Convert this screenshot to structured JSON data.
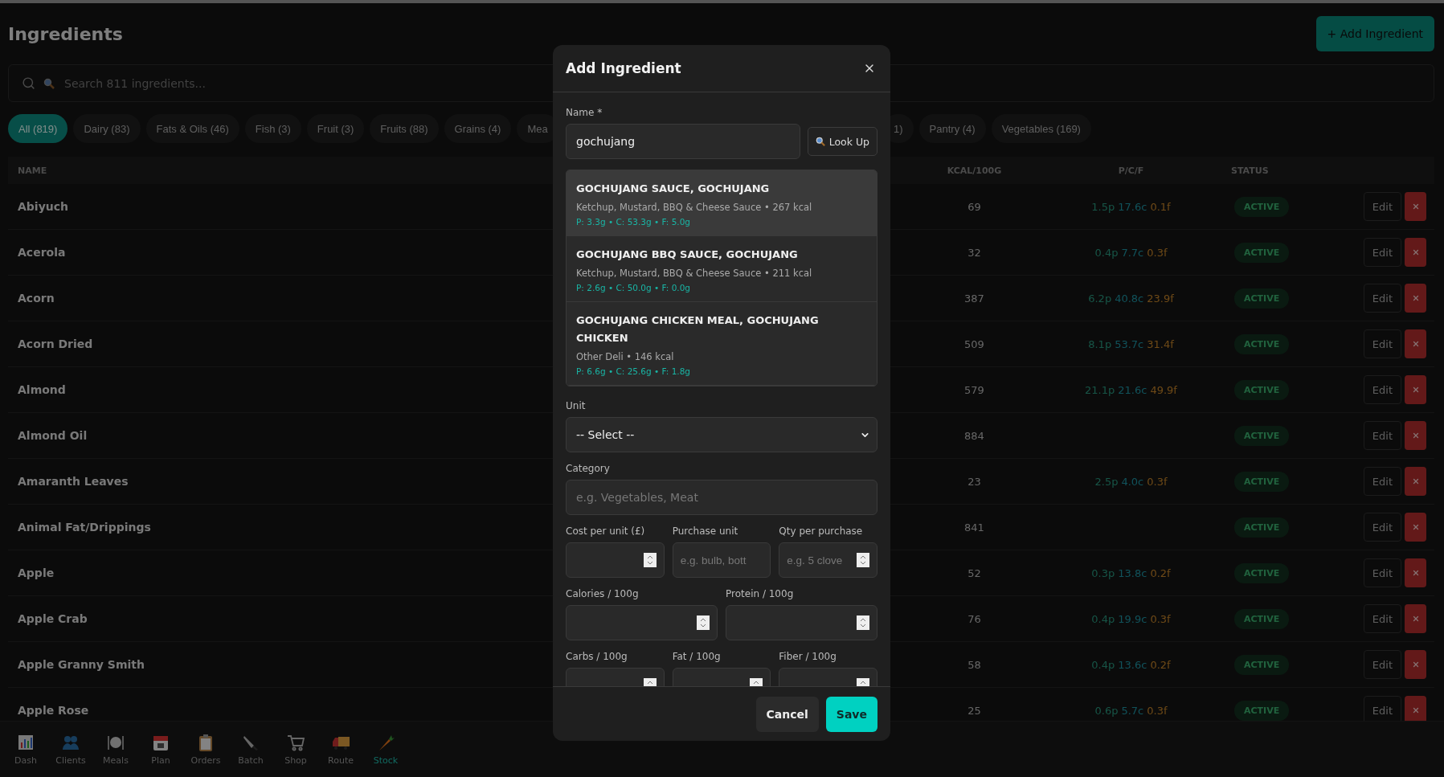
{
  "page": {
    "title": "Ingredients",
    "add_button": "+ Add Ingredient"
  },
  "search": {
    "placeholder": "Search 811 ingredients..."
  },
  "filters": [
    {
      "label": "All (819)",
      "selected": true
    },
    {
      "label": "Dairy (83)",
      "selected": false
    },
    {
      "label": "Fats & Oils (46)",
      "selected": false
    },
    {
      "label": "Fish (3)",
      "selected": false
    },
    {
      "label": "Fruit (3)",
      "selected": false
    },
    {
      "label": "Fruits (88)",
      "selected": false
    },
    {
      "label": "Grains (4)",
      "selected": false
    },
    {
      "label": "Mea",
      "selected": false
    }
  ],
  "filters_right": [
    {
      "label": "1)",
      "selected": false
    },
    {
      "label": "Pantry (4)",
      "selected": false
    },
    {
      "label": "Vegetables (169)",
      "selected": false
    }
  ],
  "table": {
    "columns": [
      "NAME",
      "KCAL/100G",
      "P/C/F",
      "STATUS"
    ],
    "rows": [
      {
        "name": "Abiyuch",
        "kcal": "69",
        "p": "1.5p",
        "c": "17.6c",
        "f": "0.1f",
        "status": "ACTIVE",
        "edit": "Edit"
      },
      {
        "name": "Acerola",
        "kcal": "32",
        "p": "0.4p",
        "c": "7.7c",
        "f": "0.3f",
        "status": "ACTIVE",
        "edit": "Edit"
      },
      {
        "name": "Acorn",
        "kcal": "387",
        "p": "6.2p",
        "c": "40.8c",
        "f": "23.9f",
        "status": "ACTIVE",
        "edit": "Edit"
      },
      {
        "name": "Acorn Dried",
        "kcal": "509",
        "p": "8.1p",
        "c": "53.7c",
        "f": "31.4f",
        "status": "ACTIVE",
        "edit": "Edit"
      },
      {
        "name": "Almond",
        "kcal": "579",
        "p": "21.1p",
        "c": "21.6c",
        "f": "49.9f",
        "status": "ACTIVE",
        "edit": "Edit"
      },
      {
        "name": "Almond Oil",
        "kcal": "884",
        "status": "ACTIVE",
        "edit": "Edit"
      },
      {
        "name": "Amaranth Leaves",
        "kcal": "23",
        "p": "2.5p",
        "c": "4.0c",
        "f": "0.3f",
        "status": "ACTIVE",
        "edit": "Edit"
      },
      {
        "name": "Animal Fat/Drippings",
        "kcal": "841",
        "status": "ACTIVE",
        "edit": "Edit"
      },
      {
        "name": "Apple",
        "kcal": "52",
        "p": "0.3p",
        "c": "13.8c",
        "f": "0.2f",
        "status": "ACTIVE",
        "edit": "Edit"
      },
      {
        "name": "Apple Crab",
        "kcal": "76",
        "p": "0.4p",
        "c": "19.9c",
        "f": "0.3f",
        "status": "ACTIVE",
        "edit": "Edit"
      },
      {
        "name": "Apple Granny Smith",
        "kcal": "58",
        "p": "0.4p",
        "c": "13.6c",
        "f": "0.2f",
        "status": "ACTIVE",
        "edit": "Edit"
      },
      {
        "name": "Apple Rose",
        "kcal": "25",
        "p": "0.6p",
        "c": "5.7c",
        "f": "0.3f",
        "status": "ACTIVE",
        "edit": "Edit"
      }
    ]
  },
  "nav": [
    {
      "label": "Dash",
      "selected": false
    },
    {
      "label": "Clients",
      "selected": false
    },
    {
      "label": "Meals",
      "selected": false
    },
    {
      "label": "Plan",
      "selected": false
    },
    {
      "label": "Orders",
      "selected": false
    },
    {
      "label": "Batch",
      "selected": false
    },
    {
      "label": "Shop",
      "selected": false
    },
    {
      "label": "Route",
      "selected": false
    },
    {
      "label": "Stock",
      "selected": true
    }
  ],
  "dialog": {
    "title": "Add Ingredient",
    "name_label": "Name *",
    "name_value": "gochujang",
    "lookup_button": "Look Up",
    "results": [
      {
        "name": "GOCHUJANG SAUCE, GOCHUJANG",
        "meta": "Ketchup, Mustard, BBQ & Cheese Sauce • 267 kcal",
        "macros": "P: 3.3g • C: 53.3g • F: 5.0g",
        "selected": true
      },
      {
        "name": "GOCHUJANG BBQ SAUCE, GOCHUJANG",
        "meta": "Ketchup, Mustard, BBQ & Cheese Sauce • 211 kcal",
        "macros": "P: 2.6g • C: 50.0g • F: 0.0g",
        "selected": false
      },
      {
        "name": "GOCHUJANG CHICKEN MEAL, GOCHUJANG CHICKEN",
        "meta": "Other Deli • 146 kcal",
        "macros": "P: 6.6g • C: 25.6g • F: 1.8g",
        "selected": false
      }
    ],
    "unit_label": "Unit",
    "unit_value": "-- Select --",
    "category_label": "Category",
    "category_placeholder": "e.g. Vegetables, Meat",
    "field_rows": [
      [
        {
          "label": "Cost per unit (£)",
          "kind": "number"
        },
        {
          "label": "Purchase unit",
          "kind": "text",
          "placeholder": "e.g. bulb, bott"
        },
        {
          "label": "Qty per purchase",
          "kind": "number",
          "placeholder": "e.g. 5 clove"
        }
      ],
      [
        {
          "label": "Calories / 100g",
          "kind": "number"
        },
        {
          "label": "Protein / 100g",
          "kind": "number"
        }
      ],
      [
        {
          "label": "Carbs / 100g",
          "kind": "number"
        },
        {
          "label": "Fat / 100g",
          "kind": "number"
        },
        {
          "label": "Fiber / 100g",
          "kind": "number"
        }
      ]
    ],
    "cancel_button": "Cancel",
    "save_button": "Save"
  }
}
